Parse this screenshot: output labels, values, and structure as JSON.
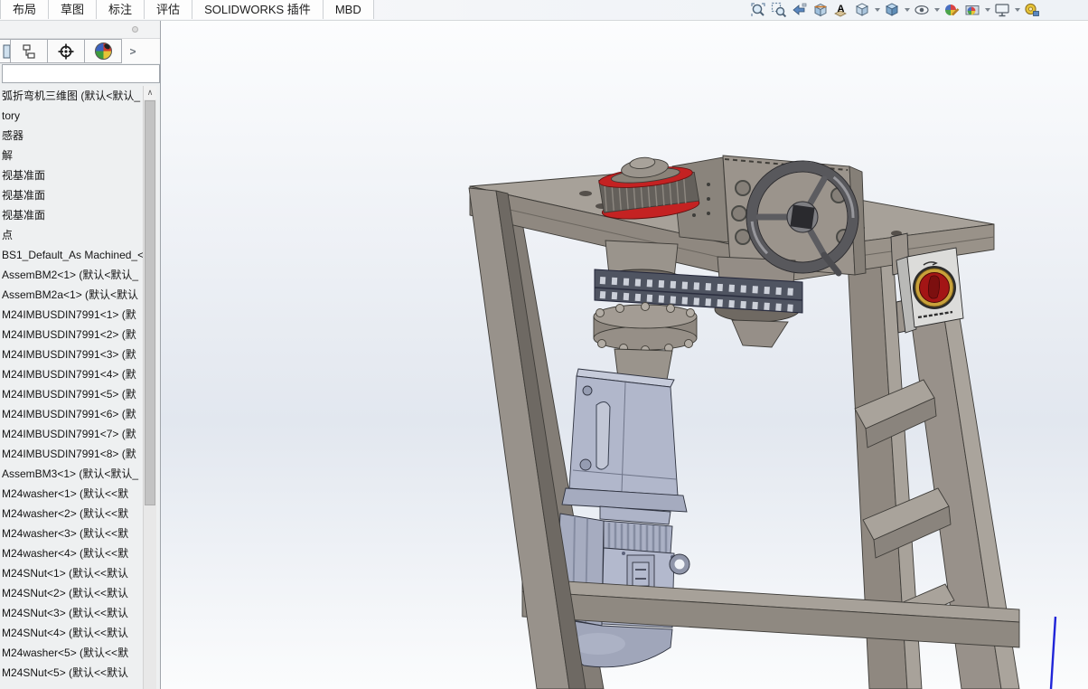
{
  "ribbon": {
    "tabs": [
      "布局",
      "草图",
      "标注",
      "评估",
      "SOLIDWORKS 插件",
      "MBD"
    ]
  },
  "headsup": {
    "annotation_glyph": "A",
    "icons": [
      {
        "name": "zoom-to-fit",
        "dropdown": false
      },
      {
        "name": "zoom-to-area",
        "dropdown": false
      },
      {
        "name": "previous-view",
        "dropdown": false
      },
      {
        "name": "section-view",
        "dropdown": false
      },
      {
        "name": "dynamic-annotation-views",
        "dropdown": false
      },
      {
        "name": "view-orientation",
        "dropdown": true
      },
      {
        "name": "display-style",
        "dropdown": true
      },
      {
        "name": "hide-show-items",
        "dropdown": true
      },
      {
        "name": "edit-appearance",
        "dropdown": false
      },
      {
        "name": "apply-scene",
        "dropdown": true
      },
      {
        "name": "view-settings",
        "dropdown": true
      },
      {
        "name": "measure",
        "dropdown": false
      }
    ]
  },
  "feature_panel": {
    "expand_glyph": ">",
    "scroll_up_glyph": "∧",
    "filter_value": "",
    "tree": [
      "弧折弯机三维图 (默认<默认_",
      "tory",
      "感器",
      "解",
      "视基准面",
      "视基准面",
      "视基准面",
      "点",
      "BS1_Default_As Machined_<",
      "AssemBM2<1> (默认<默认_",
      "AssemBM2a<1> (默认<默认",
      "M24IMBUSDIN7991<1> (默",
      "M24IMBUSDIN7991<2> (默",
      "M24IMBUSDIN7991<3> (默",
      "M24IMBUSDIN7991<4> (默",
      "M24IMBUSDIN7991<5> (默",
      "M24IMBUSDIN7991<6> (默",
      "M24IMBUSDIN7991<7> (默",
      "M24IMBUSDIN7991<8> (默",
      "AssemBM3<1> (默认<默认_",
      "M24washer<1> (默认<<默",
      "M24washer<2> (默认<<默",
      "M24washer<3> (默认<<默",
      "M24washer<4> (默认<<默",
      "M24SNut<1> (默认<<默认",
      "M24SNut<2> (默认<<默认",
      "M24SNut<3> (默认<<默认",
      "M24SNut<4> (默认<<默认",
      "M24washer<5> (默认<<默",
      "M24SNut<5> (默认<<默认"
    ]
  },
  "viewport": {
    "parts": [
      "frame-stand",
      "table-top",
      "bending-roller",
      "gearbox-head",
      "handwheel",
      "chain-drive",
      "flange-coupling",
      "gear-motor",
      "emergency-stop-box",
      "sketch-line"
    ],
    "colors": {
      "frame": "#98918a",
      "frame_light": "#a7a199",
      "frame_dark": "#827c75",
      "motor_body": "#b1b7cb",
      "motor_dark": "#9aa1b6",
      "accent_red": "#c42222",
      "estop_red": "#a31515",
      "estop_ring": "#c9a23a",
      "chain_dark": "#4f5461",
      "chain_roller": "#ccd0d9",
      "sketch_blue": "#2125d8",
      "bg_top": "#fcfdfe",
      "bg_mid": "#e2e7ef"
    }
  }
}
